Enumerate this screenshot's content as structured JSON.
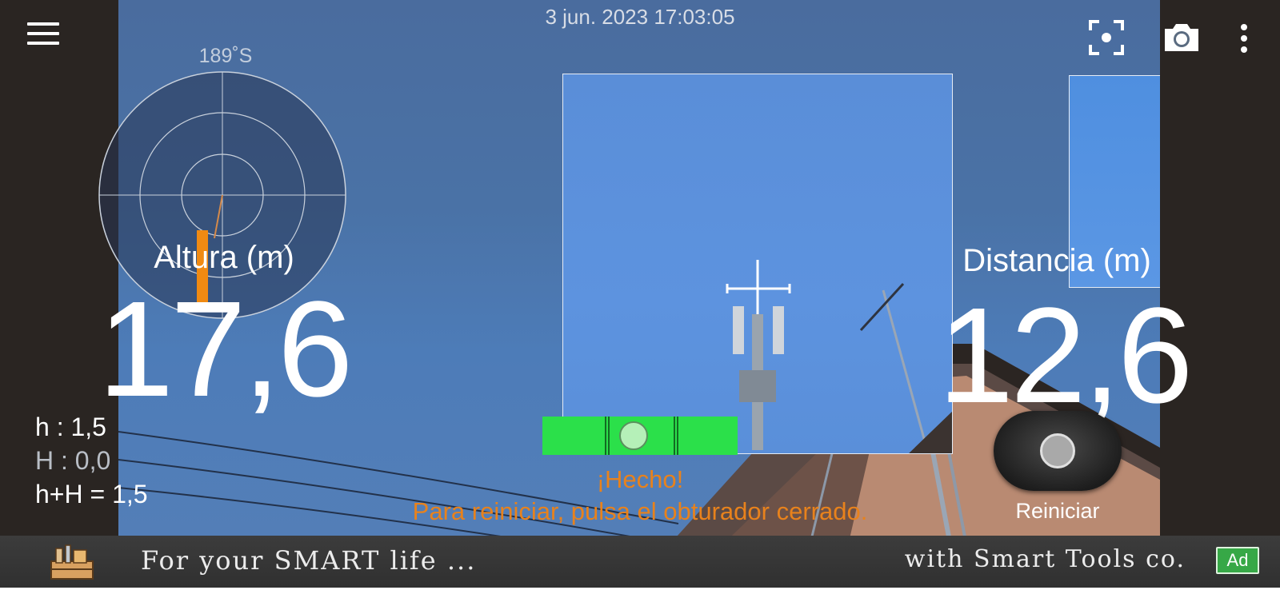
{
  "status": {
    "timestamp": "3 jun. 2023 17:03:05"
  },
  "toolbar": {
    "menu_icon": "menu-icon",
    "focus_icon": "focus-target-icon",
    "camera_icon": "camera-icon",
    "more_icon": "more-vert-icon"
  },
  "compass": {
    "heading": "189˚S"
  },
  "height": {
    "label": "Altura (m)",
    "value": "17,6"
  },
  "parameters": {
    "h": "h : 1,5",
    "H": "H : 0,0",
    "sum": "h+H = 1,5"
  },
  "level": {
    "message_title": "¡Hecho!",
    "message_body": "Para reiniciar, pulsa el obturador cerrado."
  },
  "distance": {
    "label": "Distancia (m)",
    "value": "12,6"
  },
  "shutter": {
    "label": "Reiniciar"
  },
  "ad": {
    "left_text": "For your SMART life ...",
    "right_text": "with Smart Tools co.",
    "badge": "Ad",
    "badge_color": "#37a847"
  },
  "colors": {
    "accent_orange": "#e8821c",
    "level_green": "#2be04a"
  }
}
